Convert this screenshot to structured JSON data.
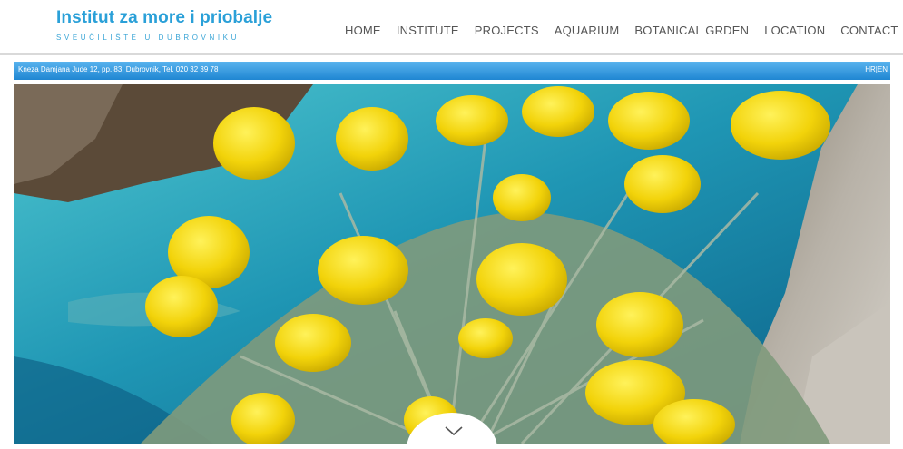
{
  "logo": {
    "title": "Institut za more i priobalje",
    "subtitle": "SVEUČILIŠTE U DUBROVNIKU"
  },
  "nav": {
    "items": [
      {
        "label": "HOME"
      },
      {
        "label": "INSTITUTE"
      },
      {
        "label": "PROJECTS"
      },
      {
        "label": "AQUARIUM"
      },
      {
        "label": "BOTANICAL GRDEN"
      },
      {
        "label": "LOCATION"
      },
      {
        "label": "CONTACT"
      }
    ]
  },
  "infobar": {
    "address": "Kneza Damjana Jude 12, pp. 83, Dubrovnik, Tel. 020 32 39 78",
    "lang_hr": "HR",
    "lang_sep": "|",
    "lang_en": "EN"
  },
  "hero": {
    "icon": "chevron-down-icon"
  },
  "colors": {
    "brand": "#2aa0d8",
    "infobar": "#2f98e0",
    "nav_text": "#555555"
  }
}
